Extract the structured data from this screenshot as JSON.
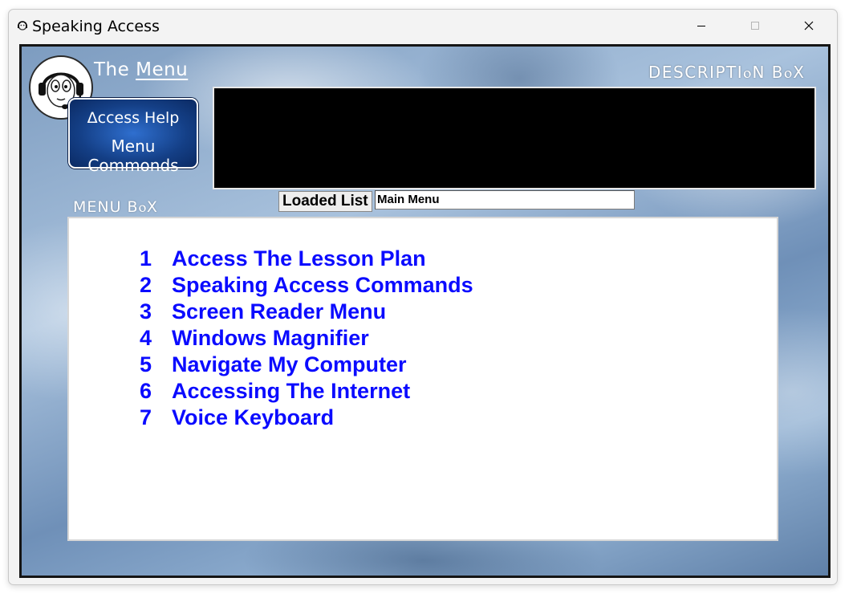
{
  "window": {
    "title": "Speaking Access",
    "controls": {
      "minimize": "–",
      "maximize": "☐",
      "close": "✕"
    }
  },
  "header": {
    "menu_title_word1": "The",
    "menu_title_word2": "Menu",
    "help_line1": "Δccess Help",
    "help_line2": "Menu Commonds",
    "description_label": "DESCRIPTIⲟN BⲟX",
    "logo_icon": "headset-face-icon"
  },
  "description": {
    "text": ""
  },
  "menu_box": {
    "label": "MENU BⲟX",
    "loaded_list_label": "Loaded List",
    "loaded_list_value": "Main Menu",
    "items": [
      {
        "num": "1",
        "label": "Access The Lesson Plan"
      },
      {
        "num": "2",
        "label": "Speaking Access Commands"
      },
      {
        "num": "3",
        "label": "Screen Reader Menu"
      },
      {
        "num": "4",
        "label": "Windows Magnifier"
      },
      {
        "num": "5",
        "label": "Navigate My Computer"
      },
      {
        "num": "6",
        "label": "Accessing The Internet"
      },
      {
        "num": "7",
        "label": "Voice Keyboard"
      }
    ]
  },
  "colors": {
    "menu_text": "#0b0bff",
    "help_button": "#143f86",
    "frame_border": "#151515"
  }
}
